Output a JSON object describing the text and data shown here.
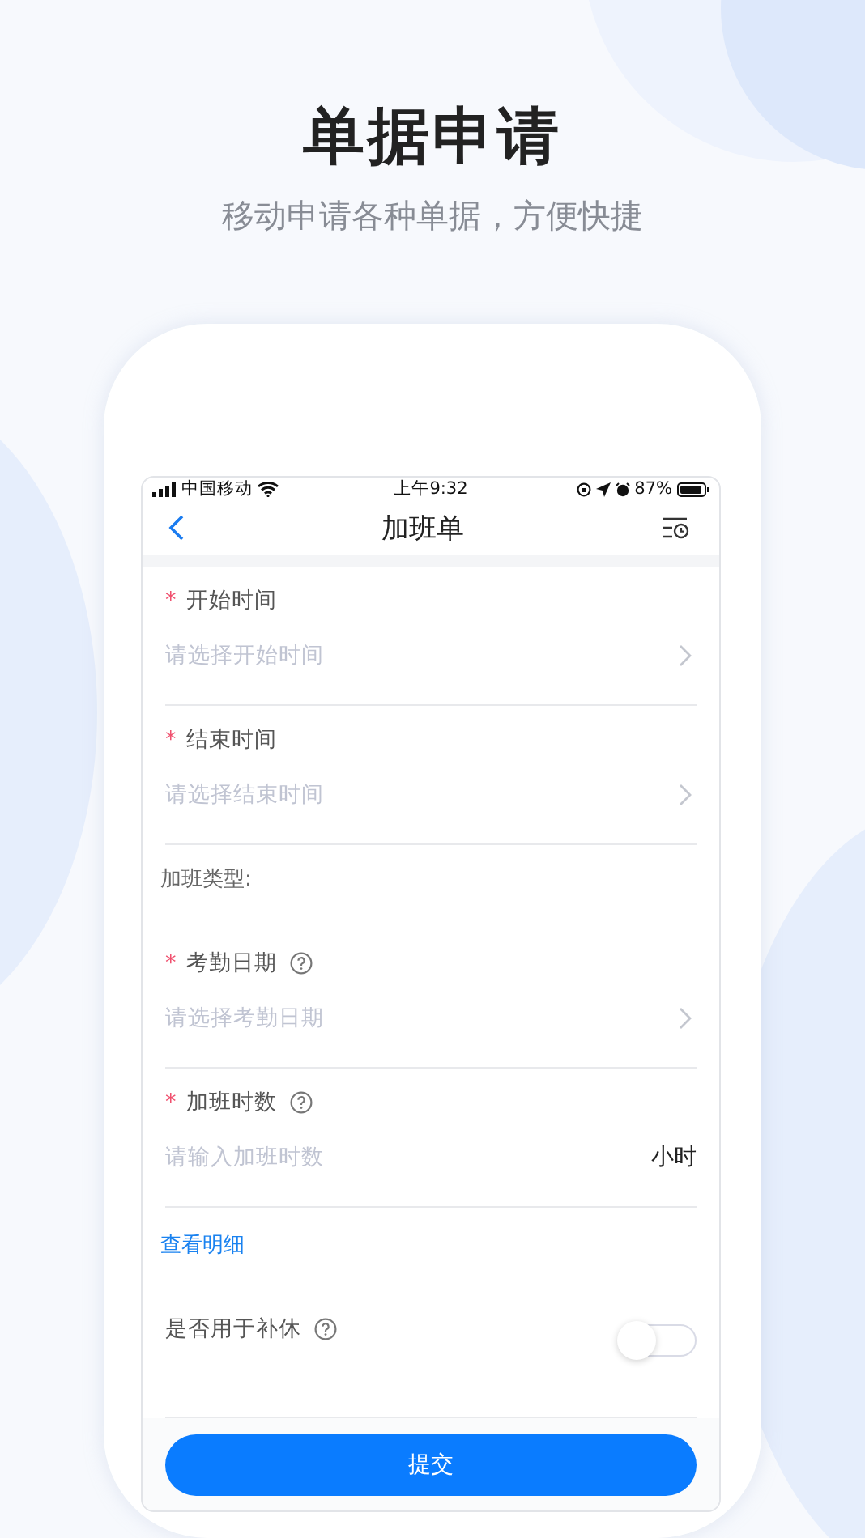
{
  "hero": {
    "title": "单据申请",
    "subtitle": "移动申请各种单据，方便快捷"
  },
  "status_bar": {
    "carrier": "中国移动",
    "time": "上午9:32",
    "battery": "87%"
  },
  "nav": {
    "title": "加班单"
  },
  "form": [
    {
      "kind": "select",
      "required_mark": "*",
      "label": "开始时间",
      "help": false,
      "placeholder": "请选择开始时间"
    },
    {
      "kind": "select",
      "required_mark": "*",
      "label": "结束时间",
      "help": false,
      "placeholder": "请选择结束时间"
    },
    {
      "kind": "section",
      "label": "加班类型:"
    },
    {
      "kind": "select",
      "required_mark": "*",
      "label": "考勤日期",
      "help": true,
      "placeholder": "请选择考勤日期"
    },
    {
      "kind": "input",
      "required_mark": "*",
      "label": "加班时数",
      "help": true,
      "placeholder": "请输入加班时数",
      "unit": "小时"
    },
    {
      "kind": "link",
      "label": "查看明细"
    },
    {
      "kind": "toggle",
      "label": "是否用于补休",
      "help": true,
      "on": false
    }
  ],
  "submit": "提交"
}
